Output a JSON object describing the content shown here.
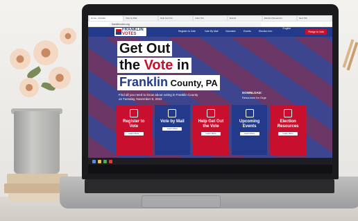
{
  "browser": {
    "tabs": [
      "Home - Franklin",
      "Vote by Mail",
      "Help Get Out",
      "Voter Info",
      "Events",
      "Election Resources",
      "New Tab"
    ],
    "url": "franklinvotes.org"
  },
  "nav": {
    "logo_top": "FRANKLIN",
    "logo_bottom": "VOTES",
    "items": [
      "Register to Vote",
      "Vote By Mail",
      "Volunteer",
      "Events",
      "Election Info"
    ],
    "language": "English",
    "cta": "Pledge to Vote"
  },
  "hero": {
    "line1": "Get Out",
    "line2_a": "the ",
    "line2_b": "Vote",
    "line2_c": " in",
    "line3_a": "Franklin",
    "line3_b": " County, PA",
    "subtitle": "Find all you need to know about voting in Franklin County on Tuesday, November 8, 2022",
    "download_title": "DOWNLOAD:",
    "download_link": "Resources for Orgs"
  },
  "cards": [
    {
      "title": "Register to\nVote",
      "button": "Learn More",
      "icon": "id-card-icon"
    },
    {
      "title": "Vote by Mail",
      "button": "Learn More",
      "icon": "mailbox-icon"
    },
    {
      "title": "Help Get Out\nthe Vote",
      "button": "Learn More",
      "icon": "pencil-icon"
    },
    {
      "title": "Upcoming\nEvents",
      "button": "Learn More",
      "icon": "calendar-icon"
    },
    {
      "title": "Election\nResources",
      "button": "Learn More",
      "icon": "checklist-icon"
    }
  ],
  "colors": {
    "brand_red": "#c8102e",
    "brand_blue": "#233a8a"
  }
}
